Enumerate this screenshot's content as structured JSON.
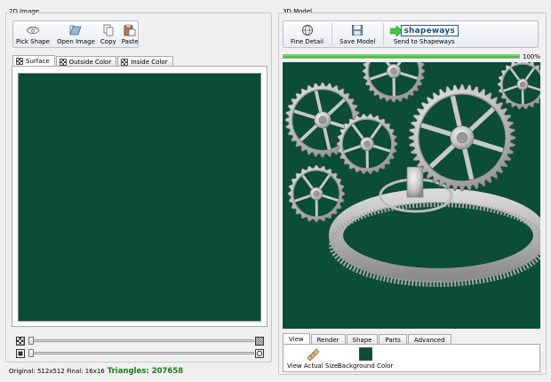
{
  "left_panel": {
    "title": "2D Image",
    "toolbar": [
      {
        "label": "Pick Shape",
        "icon": "pick-shape-icon"
      },
      {
        "label": "Open Image",
        "icon": "open-image-icon"
      },
      {
        "label": "Copy",
        "icon": "copy-icon"
      },
      {
        "label": "Paste",
        "icon": "paste-icon"
      }
    ],
    "tabs": [
      "Surface",
      "Outside Color",
      "Inside Color"
    ],
    "active_tab": "Surface",
    "canvas_color": "#0b4d36",
    "status": {
      "dims": "Original: 512x512 Final: 16x16",
      "triangles": "Triangles: 207658"
    }
  },
  "right_panel": {
    "title": "3D Model",
    "toolbar": [
      {
        "label": "Fine Detail",
        "icon": "globe-icon"
      },
      {
        "label": "Save Model",
        "icon": "save-icon"
      },
      {
        "label": "Send to Shapeways",
        "icon": "shapeways-logo",
        "logo_text": "shapeways"
      }
    ],
    "progress": {
      "value": 100,
      "label": "100%"
    },
    "viewport_bg": "#0b4d36",
    "tabs": [
      "View",
      "Render",
      "Shape",
      "Parts",
      "Advanced"
    ],
    "active_tab": "View",
    "view_buttons": [
      {
        "label": "View Actual Size",
        "icon": "ruler-icon"
      },
      {
        "label": "Background Color",
        "icon": "color-swatch-icon"
      }
    ]
  },
  "colors": {
    "accent_green": "#3ccd3c",
    "triangles_text": "#1a7a1a",
    "progress_green": "#33cc33"
  }
}
